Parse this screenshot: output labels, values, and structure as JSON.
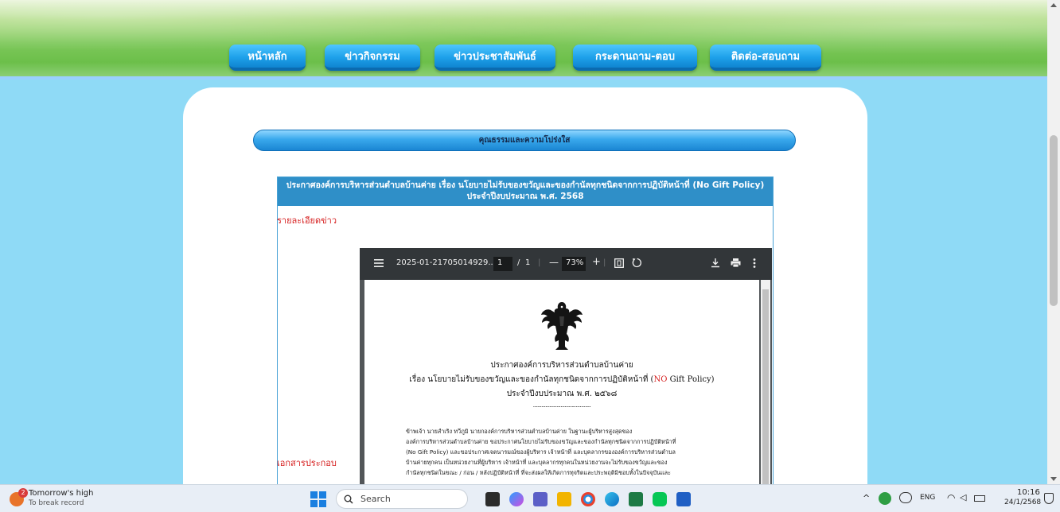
{
  "nav": {
    "items": [
      "หน้าหลัก",
      "ข่าวกิจกรรม",
      "ข่าวประชาสัมพันธ์",
      "กระดานถาม-ตอบ",
      "ติดต่อ-สอบถาม"
    ]
  },
  "section_title": "คุณธรรมและความโปร่งใส",
  "news": {
    "header": "ประกาศองค์การบริหารส่วนตำบลบ้านค่าย เรื่อง นโยบายไม่รับของขวัญและของกำนัลทุกชนิดจากการปฏิบัติหน้าที่ (No Gift Policy) ประจำปีงบประมาณ พ.ศ. 2568",
    "detail_label": "รายละเอียดข่าว",
    "attachment_label": "เอกสารประกอบ"
  },
  "pdf": {
    "filename": "2025-01-21705014929...",
    "page_current": "1",
    "page_sep": "/",
    "page_total": "1",
    "zoom": "73%",
    "doc_title_1": "ประกาศองค์การบริหารส่วนตำบลบ้านค่าย",
    "doc_title_2a": "เรื่อง นโยบายไม่รับของขวัญและของกำนัลทุกชนิดจากการปฏิบัติหน้าที่ (",
    "doc_title_2b": "NO",
    "doc_title_2c": " Gift Policy)",
    "doc_title_3": "ประจำปีงบประมาณ พ.ศ. ๒๕๖๘",
    "doc_dots": "..........................................",
    "doc_body": [
      "              ข้าพเจ้า นายสำเริง  ทวีภูมิ นายกองค์การบริหารส่วนตำบลบ้านค่าย ในฐานะผู้บริหารสูงสุดของ",
      "องค์การบริหารส่วนตำบลบ้านค่าย ขอประกาศนโยบายไม่รับของขวัญและของกำนัลทุกชนิดจากการปฏิบัติหน้าที่",
      "(No Gift Policy) และขอประกาศเจตนารมณ์ของผู้บริหาร เจ้าหน้าที่ และบุคลากรขององค์การบริหารส่วนตำบล",
      "บ้านค่ายทุกคน เป็นหน่วยงานที่ผู้บริหาร เจ้าหน้าที่ และบุคลากรทุกคนในหน่วยงานจะไม่รับของขวัญและของ",
      "กำนัลทุกชนิดในขณะ / ก่อน / หลังปฏิบัติหน้าที่ ที่จะส่งผลให้เกิดการทุจริตและประพฤติมิชอบทั้งในปัจจุบันและ"
    ]
  },
  "taskbar": {
    "weather_badge": "2",
    "weather_title": "Tomorrow's high",
    "weather_sub": "To break record",
    "search_placeholder": "Search",
    "lang": "ENG",
    "time": "10:16",
    "date": "24/1/2568"
  },
  "colors": {
    "nav_blue": "#1ea1ea",
    "header_blue": "#2f8fc8",
    "label_red": "#d62020",
    "sky": "#8fdaf6"
  }
}
